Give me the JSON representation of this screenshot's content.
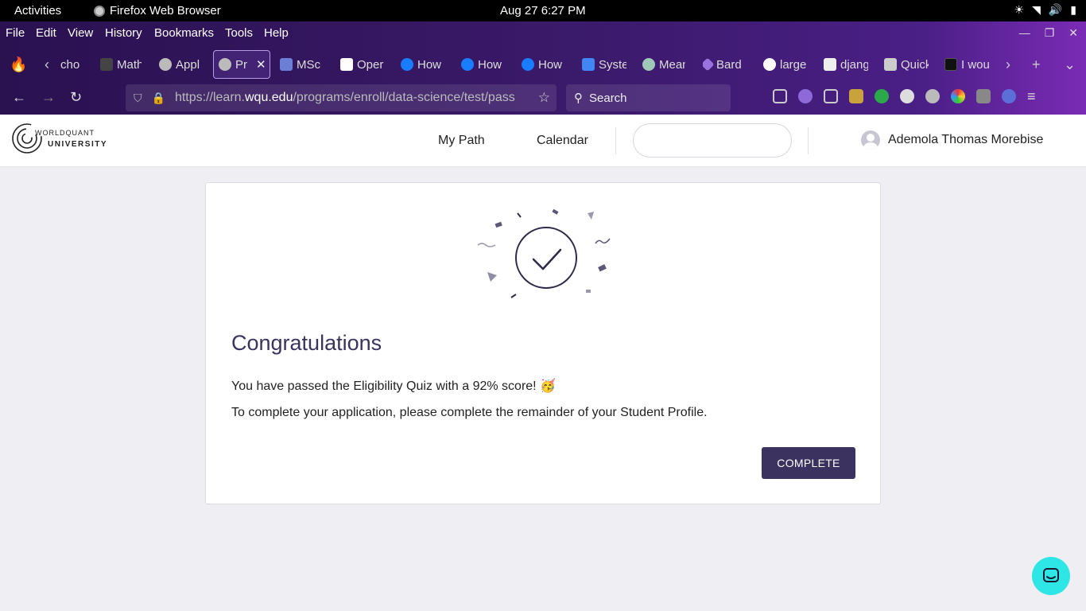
{
  "system_bar": {
    "activities": "Activities",
    "app_name": "Firefox Web Browser",
    "datetime": "Aug 27   6:27 PM"
  },
  "browser": {
    "menu": [
      "File",
      "Edit",
      "View",
      "History",
      "Bookmarks",
      "Tools",
      "Help"
    ],
    "tabs": [
      {
        "label": "cho",
        "icon": "back-chevron"
      },
      {
        "label": "Math",
        "icon": "generic"
      },
      {
        "label": "Appl",
        "icon": "wqu"
      },
      {
        "label": "Pr",
        "icon": "wqu",
        "active": true
      },
      {
        "label": "MSc",
        "icon": "calendar"
      },
      {
        "label": "Oper",
        "icon": "profile"
      },
      {
        "label": "How",
        "icon": "digitalocean"
      },
      {
        "label": "How",
        "icon": "digitalocean"
      },
      {
        "label": "How",
        "icon": "digitalocean"
      },
      {
        "label": "Syste",
        "icon": "docs"
      },
      {
        "label": "Mean",
        "icon": "chatgpt"
      },
      {
        "label": "Bard",
        "icon": "bard"
      },
      {
        "label": "large",
        "icon": "google"
      },
      {
        "label": "djang",
        "icon": "cube"
      },
      {
        "label": "Quick",
        "icon": "book"
      },
      {
        "label": "I wou",
        "icon": "p"
      }
    ],
    "url_prefix": "https://learn.",
    "url_domain": "wqu.edu",
    "url_path": "/programs/enroll/data-science/test/pass",
    "search_placeholder": "Search"
  },
  "site": {
    "logo_line1": "WORLDQUANT",
    "logo_line2": "UNIVERSITY",
    "nav": [
      "My Path",
      "Calendar"
    ],
    "user_name": "Ademola Thomas Morebise"
  },
  "card": {
    "title": "Congratulations",
    "line1": "You have passed the Eligibility Quiz with a 92% score! 🥳",
    "line2": "To complete your application, please complete the remainder of your Student Profile.",
    "button": "COMPLETE"
  },
  "colors": {
    "brand": "#3b3260",
    "chat": "#2ee6e6",
    "page_bg": "#efeef3"
  }
}
